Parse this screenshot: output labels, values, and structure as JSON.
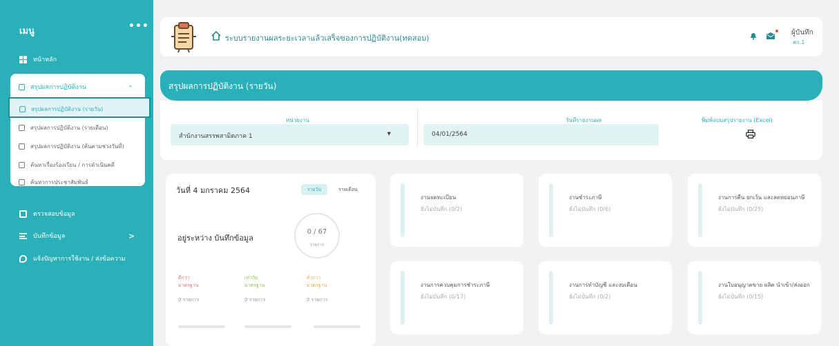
{
  "sidebar": {
    "menu_title": "เมนู",
    "dots": "•••",
    "home": "หน้าหลัก",
    "group_title": "สรุปผลการปฏิบัติงาน",
    "submenu": [
      "สรุปผลการปฏิบัติงาน (รายวัน)",
      "สรุปผลการปฏิบัติงาน (รายเดือน)",
      "สรุปผลการปฏิบัติงาน (ค้นตามช่วงวันที่)",
      "ค้นหาเรื่องร้องเรียน / การดำเนินคดี",
      "ค้นหาการประชาสัมพันธ์"
    ],
    "data_review": "ตรวจสอบข้อมูล",
    "record_data": "บันทึกข้อมูล",
    "record_chevron": ">",
    "report_issue": "แจ้งปัญหาการใช้งาน / ส่งข้อความ"
  },
  "topbar": {
    "title": "ระบบรายงานผลระยะเวลาแล้วเสร็จของการปฏิบัติงาน(ทดสอบ)",
    "user_name": "ผู้บันทึก",
    "user_role": "สก.1"
  },
  "page": {
    "title": "สรุปผลการปฏิบัติงาน (รายวัน)"
  },
  "filters": {
    "unit_label": "หน่วยงาน",
    "unit_value": "สำนักงานสรรพสามิตภาค 1",
    "date_label": "วันที่รายงานผล",
    "date_value": "04/01/2564",
    "print_label": "พิมพ์แบบสรุปรายงาน (Excel)"
  },
  "summary": {
    "date": "วันที่ 4 มกราคม 2564",
    "tab_day": "รายวัน",
    "tab_month": "รายเดือน",
    "status": "อยู่ระหว่าง บันทึกข้อมูล",
    "progress": "0 / 67",
    "progress_unit": "รายการ",
    "stats": [
      {
        "line1": "ดีกว่า",
        "line2": "มาตรฐาน",
        "count": "0 รายการ",
        "color": "#e57373"
      },
      {
        "line1": "เท่ากับ",
        "line2": "มาตรฐาน",
        "count": "0 รายการ",
        "color": "#8bc34a"
      },
      {
        "line1": "ต่ำกว่า",
        "line2": "มาตรฐาน",
        "count": "0 รายการ",
        "color": "#f5b041"
      }
    ]
  },
  "tasks": [
    {
      "title": "งานจดทะเบียน",
      "status": "ยังไม่บันทึก (0/2)"
    },
    {
      "title": "งานชำระภาษี",
      "status": "ยังไม่บันทึก (0/6)"
    },
    {
      "title": "งานการคืน ยกเว้น และลดหย่อนภาษี",
      "status": "ยังไม่บันทึก (0/25)"
    },
    {
      "title": "งานการควบคุมการชำระภาษี",
      "status": "ยังไม่บันทึก (0/17)"
    },
    {
      "title": "งานการทำบัญชี และงบเดือน",
      "status": "ยังไม่บันทึก (0/2)"
    },
    {
      "title": "งานใบอนุญาตขาย ผลิต นำเข้า/ส่งออก",
      "status": "ยังไม่บันทึก (0/15)"
    }
  ],
  "colors": {
    "accent": "#2ab0b8",
    "active_border": "#2a8c93"
  }
}
